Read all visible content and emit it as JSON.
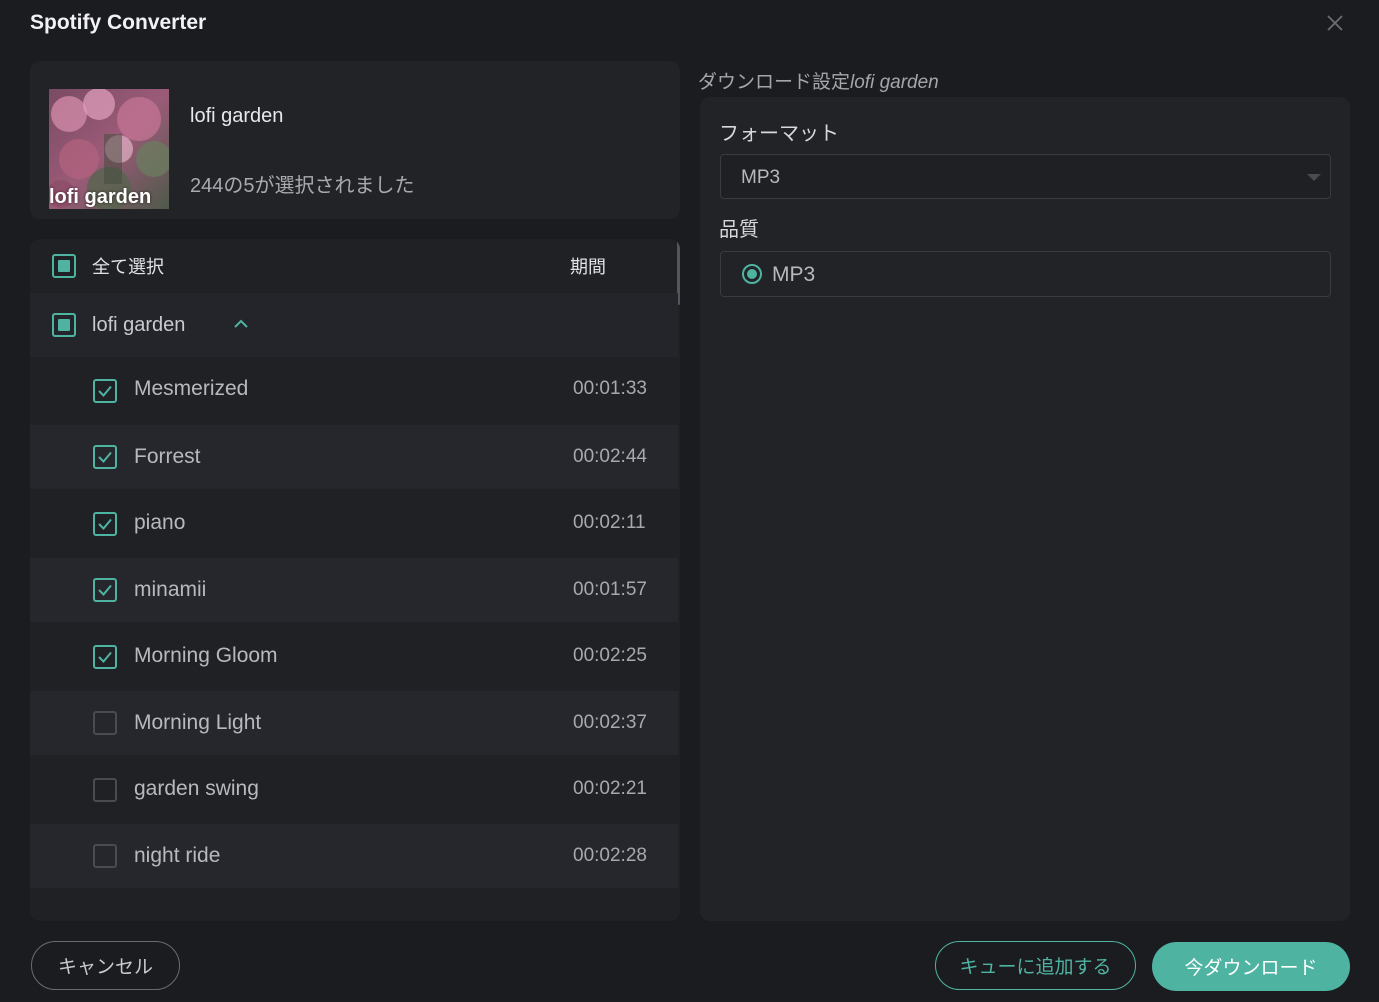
{
  "window": {
    "title": "Spotify Converter"
  },
  "album": {
    "name": "lofi garden",
    "cover_text": "lofi garden",
    "selection_text": "244の5が選択されました"
  },
  "list": {
    "select_all_label": "全て選択",
    "duration_header": "期間",
    "group_label": "lofi garden",
    "tracks": [
      {
        "name": "Mesmerized",
        "duration": "00:01:33",
        "checked": true
      },
      {
        "name": "Forrest",
        "duration": "00:02:44",
        "checked": true
      },
      {
        "name": "piano",
        "duration": "00:02:11",
        "checked": true
      },
      {
        "name": "minamii",
        "duration": "00:01:57",
        "checked": true
      },
      {
        "name": "Morning Gloom",
        "duration": "00:02:25",
        "checked": true
      },
      {
        "name": "Morning Light",
        "duration": "00:02:37",
        "checked": false
      },
      {
        "name": "garden swing",
        "duration": "00:02:21",
        "checked": false
      },
      {
        "name": "night ride",
        "duration": "00:02:28",
        "checked": false
      }
    ]
  },
  "settings": {
    "header_prefix": "ダウンロード設定",
    "header_album": "lofi garden",
    "format_label": "フォーマット",
    "format_value": "MP3",
    "quality_label": "品質",
    "quality_option": "MP3"
  },
  "buttons": {
    "cancel": "キャンセル",
    "add_to_queue": "キューに追加する",
    "download_now": "今ダウンロード"
  },
  "colors": {
    "accent": "#4fb3a1",
    "background": "#1b1c20",
    "panel": "#222327"
  }
}
